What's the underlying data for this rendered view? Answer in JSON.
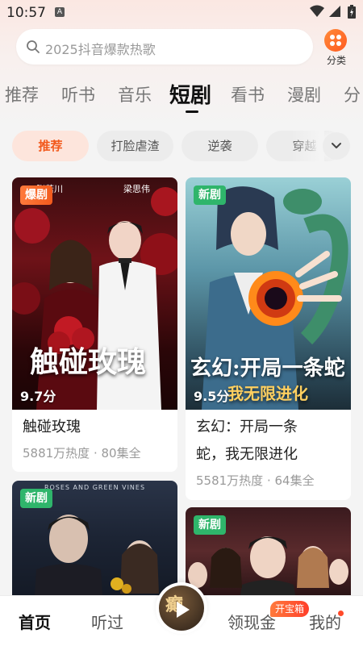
{
  "status_bar": {
    "time": "10:57",
    "notification_icon": "A"
  },
  "search": {
    "placeholder": "2025抖音爆款热歌"
  },
  "category": {
    "label": "分类"
  },
  "main_tabs": [
    {
      "label": "推荐"
    },
    {
      "label": "听书"
    },
    {
      "label": "音乐"
    },
    {
      "label": "短剧",
      "active": true
    },
    {
      "label": "看书"
    },
    {
      "label": "漫剧"
    },
    {
      "label": "分"
    }
  ],
  "chips": [
    {
      "label": "推荐",
      "active": true
    },
    {
      "label": "打脸虐渣"
    },
    {
      "label": "逆袭"
    },
    {
      "label": "穿越"
    }
  ],
  "cards": [
    {
      "badge": "爆剧",
      "score": "9.7分",
      "title": "触碰玫瑰",
      "meta": "5881万热度 · 80集全",
      "poster_title": "触碰玫瑰",
      "poster_credit_left": "张若川",
      "poster_credit_right": "梁思伟"
    },
    {
      "badge": "新剧",
      "score": "9.5分",
      "title": "玄幻：开局一条蛇，我无限进化",
      "title_line1": "玄幻：开局一条",
      "title_line2": "蛇，我无限进化",
      "meta": "5581万热度 · 64集全",
      "poster_title_1": "玄幻:开局一条蛇",
      "poster_title_2": "我无限进化"
    },
    {
      "badge": "新剧",
      "poster_header": "ROSES AND GREEN VINES"
    },
    {
      "badge": "新剧"
    }
  ],
  "bottom_nav": {
    "items": [
      {
        "label": "首页",
        "active": true
      },
      {
        "label": "听过"
      },
      {
        "label": "领现金"
      },
      {
        "label": "我的"
      }
    ],
    "center_cover_text": "癫",
    "treasure_badge": "开宝箱"
  },
  "colors": {
    "accent": "#f25a1d",
    "new_badge": "#2fb56b"
  }
}
